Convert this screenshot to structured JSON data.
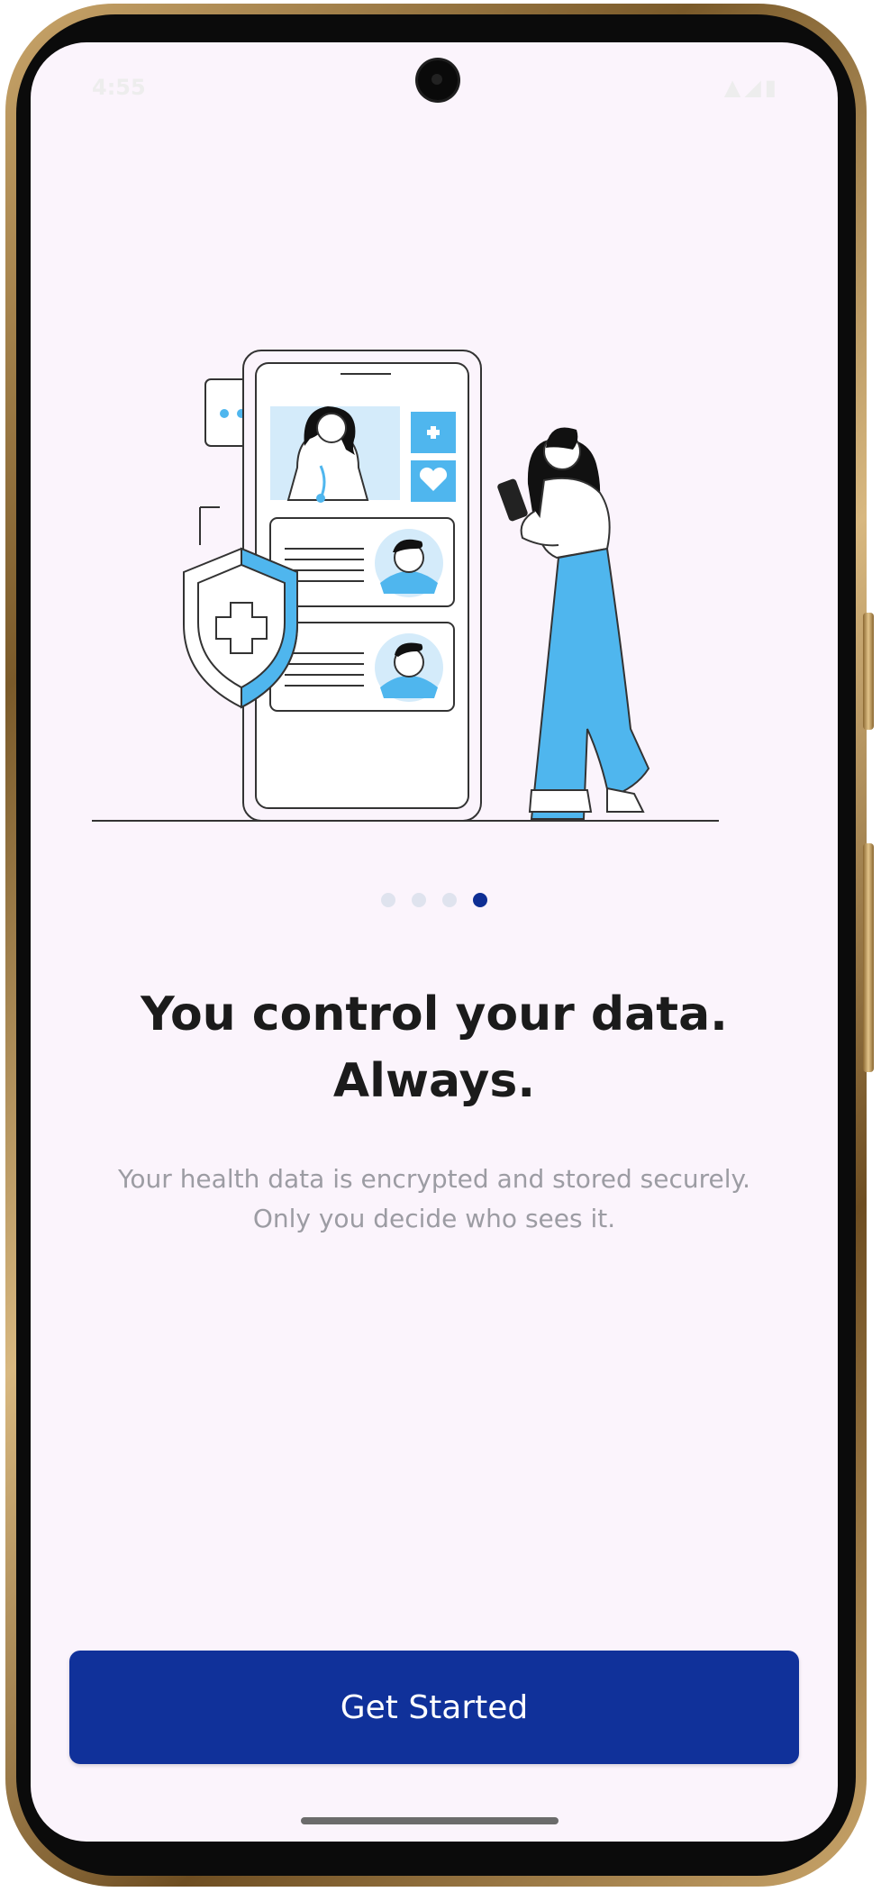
{
  "status_bar": {
    "time": "4:55",
    "icons": [
      "sync-icon",
      "signal-icon",
      "wifi-icon",
      "battery-icon"
    ]
  },
  "onboarding": {
    "illustration": "doctor-app-phone-with-shield-and-woman",
    "pagination": {
      "total": 4,
      "current": 4
    },
    "headline": [
      "You control your data.",
      "Always."
    ],
    "description": [
      "Your health data is encrypted and stored securely.",
      "Only you decide who sees it."
    ],
    "cta_label": "Get Started"
  },
  "colors": {
    "background": "#fbf4fc",
    "primary": "#10319a",
    "accent": "#4fb6ee",
    "headline": "#1b1b1b",
    "subtext": "#9c9ca3"
  }
}
